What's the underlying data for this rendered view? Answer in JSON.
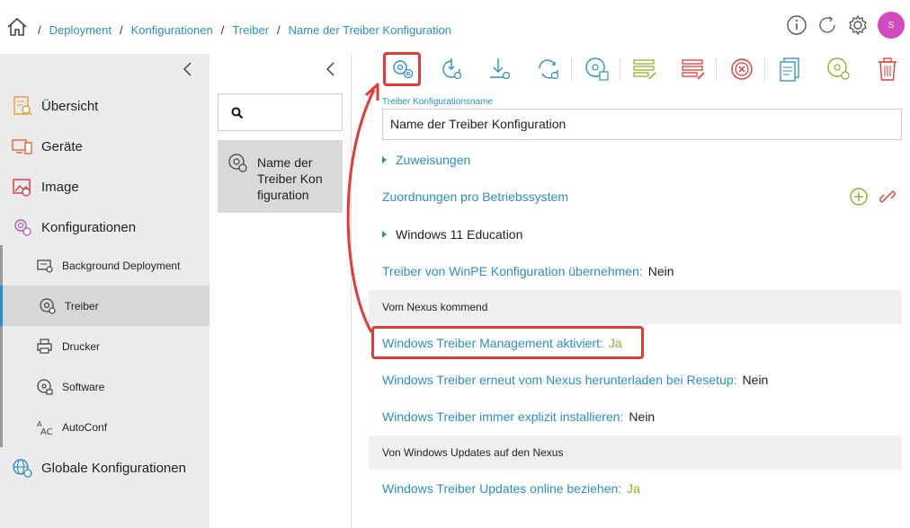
{
  "breadcrumb": {
    "sep": "/",
    "items": [
      "Deployment",
      "Konfigurationen",
      "Treiber",
      "Name der Treiber Konfiguration"
    ]
  },
  "header": {
    "avatar_initial": "S"
  },
  "sidebar": {
    "items": [
      {
        "label": "Übersicht",
        "icon": "overview-icon"
      },
      {
        "label": "Geräte",
        "icon": "devices-icon"
      },
      {
        "label": "Image",
        "icon": "image-icon"
      },
      {
        "label": "Konfigurationen",
        "icon": "configurations-icon"
      }
    ],
    "sub_items": [
      {
        "label": "Background Deployment",
        "icon": "background-deployment-icon"
      },
      {
        "label": "Treiber",
        "icon": "driver-icon",
        "active": true
      },
      {
        "label": "Drucker",
        "icon": "printer-icon"
      },
      {
        "label": "Software",
        "icon": "software-icon"
      },
      {
        "label": "AutoConf",
        "icon": "autoconf-icon"
      }
    ],
    "global": {
      "label": "Globale Konfigurationen",
      "icon": "globe-gear-icon"
    }
  },
  "middle": {
    "selected_item": "Name der Treiber Kon figuration"
  },
  "form": {
    "name_label": "Treiber Konfigurationsname",
    "name_value": "Name der Treiber Konfiguration",
    "assignments": "Zuweisungen",
    "os_mapping": "Zuordnungen pro Betriebssystem",
    "os_entry": "Windows 11 Education",
    "winpe_label": "Treiber von WinPE Konfiguration übernehmen:",
    "winpe_value": "Nein",
    "section_nexus": "Vom Nexus kommend",
    "mgmt_label": "Windows Treiber Management aktiviert:",
    "mgmt_value": "Ja",
    "redownload_label": "Windows Treiber erneut vom Nexus herunterladen bei Resetup:",
    "redownload_value": "Nein",
    "explicit_label": "Windows Treiber immer explizit installieren:",
    "explicit_value": "Nein",
    "section_updates": "Von Windows Updates auf den Nexus",
    "online_label": "Windows Treiber Updates online beziehen:",
    "online_value": "Ja"
  },
  "colors": {
    "accent": "#2b8fc7",
    "highlight": "#e53935",
    "green": "#8ab42a",
    "avatar": "#d24ac0"
  }
}
